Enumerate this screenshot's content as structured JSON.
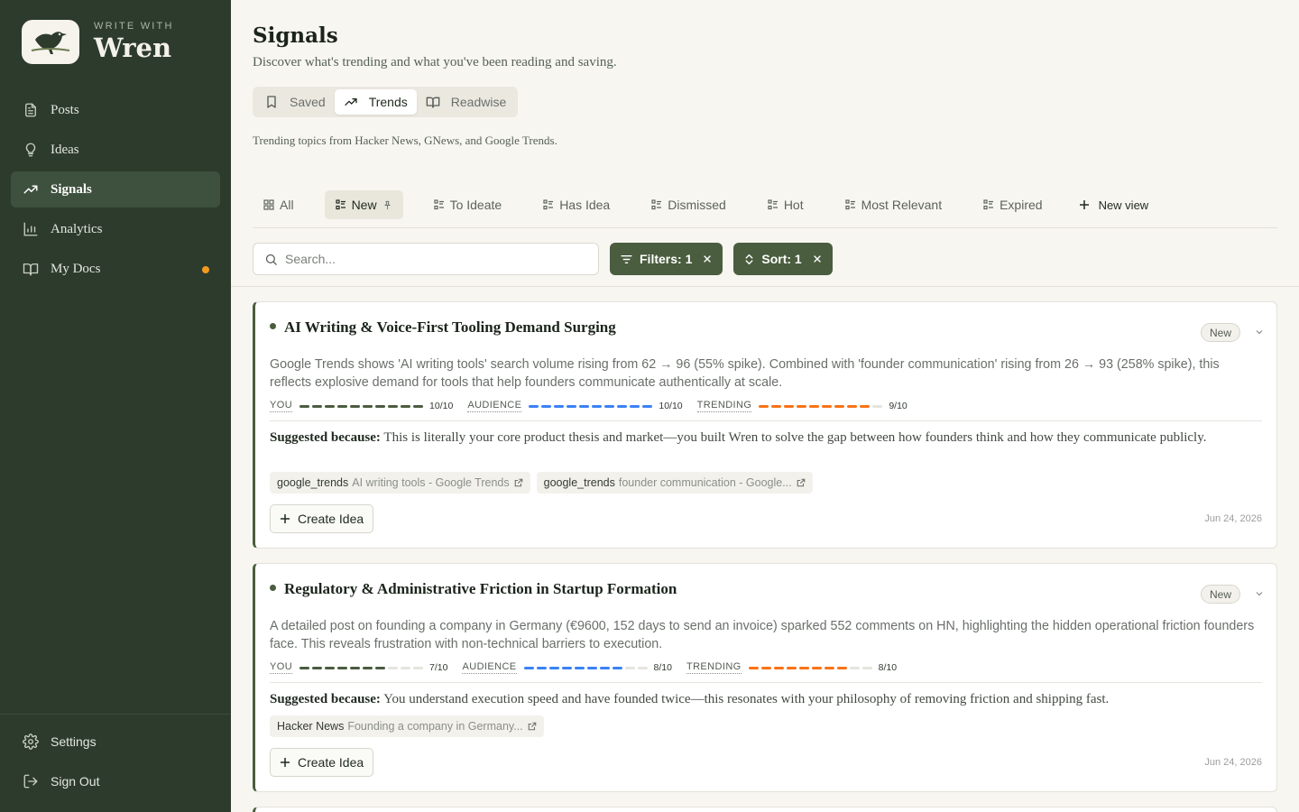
{
  "brand": {
    "tagline": "WRITE WITH",
    "name": "Wren"
  },
  "sidebar": {
    "items": [
      {
        "label": "Posts",
        "icon": "document-icon"
      },
      {
        "label": "Ideas",
        "icon": "lightbulb-icon"
      },
      {
        "label": "Signals",
        "icon": "trending-icon",
        "active": true
      },
      {
        "label": "Analytics",
        "icon": "bar-chart-icon"
      },
      {
        "label": "My Docs",
        "icon": "book-icon",
        "dot": true
      }
    ],
    "footer": [
      {
        "label": "Settings",
        "icon": "gear-icon"
      },
      {
        "label": "Sign Out",
        "icon": "sign-out-icon"
      }
    ]
  },
  "header": {
    "title": "Signals",
    "subtitle": "Discover what's trending and what you've been reading and saving."
  },
  "segments": [
    {
      "label": "Saved",
      "icon": "bookmark-icon"
    },
    {
      "label": "Trends",
      "icon": "trending-icon",
      "active": true
    },
    {
      "label": "Readwise",
      "icon": "book-icon"
    }
  ],
  "segment_note": "Trending topics from Hacker News, GNews, and Google Trends.",
  "views": [
    {
      "label": "All",
      "icon": "grid-icon"
    },
    {
      "label": "New",
      "icon": "list-icon",
      "active": true,
      "pinned": true
    },
    {
      "label": "To Ideate",
      "icon": "list-icon"
    },
    {
      "label": "Has Idea",
      "icon": "list-icon"
    },
    {
      "label": "Dismissed",
      "icon": "list-icon"
    },
    {
      "label": "Hot",
      "icon": "list-icon"
    },
    {
      "label": "Most Relevant",
      "icon": "list-icon"
    },
    {
      "label": "Expired",
      "icon": "list-icon"
    }
  ],
  "new_view_label": "New view",
  "search": {
    "placeholder": "Search...",
    "value": ""
  },
  "filters_label": "Filters: 1",
  "sort_label": "Sort: 1",
  "colors": {
    "accent": "#4a5d3f",
    "sidebar_bg": "#2d3b2d",
    "you": "#4a5d3f",
    "audience": "#3b82f6",
    "trending": "#f97316",
    "notification_dot": "#f39a1e"
  },
  "signals": [
    {
      "title": "AI Writing & Voice-First Tooling Demand Surging",
      "status": "New",
      "description": "Google Trends shows 'AI writing tools' search volume rising from 62 → 96 (55% spike). Combined with 'founder communication' rising from 26 → 93 (258% spike), this reflects explosive demand for tools that help founders communicate authentically at scale.",
      "scores": {
        "you": 10,
        "audience": 10,
        "trending": 9,
        "max": 10
      },
      "score_labels": {
        "you": "YOU",
        "audience": "AUDIENCE",
        "trending": "TRENDING"
      },
      "score_texts": {
        "you": "10/10",
        "audience": "10/10",
        "trending": "9/10"
      },
      "because_label": "Suggested because:",
      "because_text": " This is literally your core product thesis and market—you built Wren to solve the gap between how founders think and how they communicate publicly.",
      "sources": [
        {
          "name": "google_trends",
          "title": "AI writing tools - Google Trends"
        },
        {
          "name": "google_trends",
          "title": "founder communication - Google..."
        }
      ],
      "create_label": "Create Idea",
      "date": "Jun 24, 2026"
    },
    {
      "title": "Regulatory & Administrative Friction in Startup Formation",
      "status": "New",
      "description": "A detailed post on founding a company in Germany (€9600, 152 days to send an invoice) sparked 552 comments on HN, highlighting the hidden operational friction founders face. This reveals frustration with non-technical barriers to execution.",
      "scores": {
        "you": 7,
        "audience": 8,
        "trending": 8,
        "max": 10
      },
      "score_labels": {
        "you": "YOU",
        "audience": "AUDIENCE",
        "trending": "TRENDING"
      },
      "score_texts": {
        "you": "7/10",
        "audience": "8/10",
        "trending": "8/10"
      },
      "because_label": "Suggested because:",
      "because_text": " You understand execution speed and have founded twice—this resonates with your philosophy of removing friction and shipping fast.",
      "sources": [
        {
          "name": "Hacker News",
          "title": "Founding a company in Germany..."
        }
      ],
      "create_label": "Create Idea",
      "date": "Jun 24, 2026"
    }
  ]
}
